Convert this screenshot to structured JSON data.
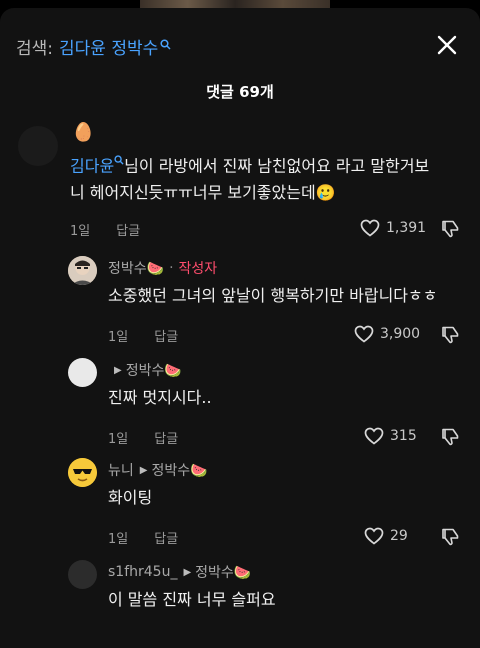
{
  "header": {
    "label": "검색:",
    "query": "김다윤 정박수",
    "query_icon": "search-superscript-icon"
  },
  "count_label": "댓글 69개",
  "comments": [
    {
      "username": "🥚",
      "mention": "김다윤",
      "text_after_mention": "님이 라방에서 진짜 남친없어요 라고 말한거보",
      "text_line2": "니 헤어지신듯ㅠㅠ너무 보기좋았는데🥲",
      "time": "1일",
      "reply": "답글",
      "likes": "1,391"
    },
    {
      "username": "정박수🍉",
      "author_label": "작성자",
      "text": "소중했던 그녀의 앞날이 행복하기만 바랍니다ㅎㅎ",
      "time": "1일",
      "reply": "답글",
      "likes": "3,900"
    },
    {
      "username": "",
      "reply_to": "정박수🍉",
      "text": "진짜 멋지시다..",
      "time": "1일",
      "reply": "답글",
      "likes": "315"
    },
    {
      "username": "뉴니",
      "reply_to": "정박수🍉",
      "text": "화이팅",
      "time": "1일",
      "reply": "답글",
      "likes": "29"
    },
    {
      "username": "s1fhr45u_",
      "reply_to": "정박수🍉",
      "text": "이 말씀 진짜 너무 슬퍼요"
    }
  ],
  "colors": {
    "accent": "#4aa3ff",
    "author": "#ff4d6d",
    "sheet": "#121212"
  }
}
